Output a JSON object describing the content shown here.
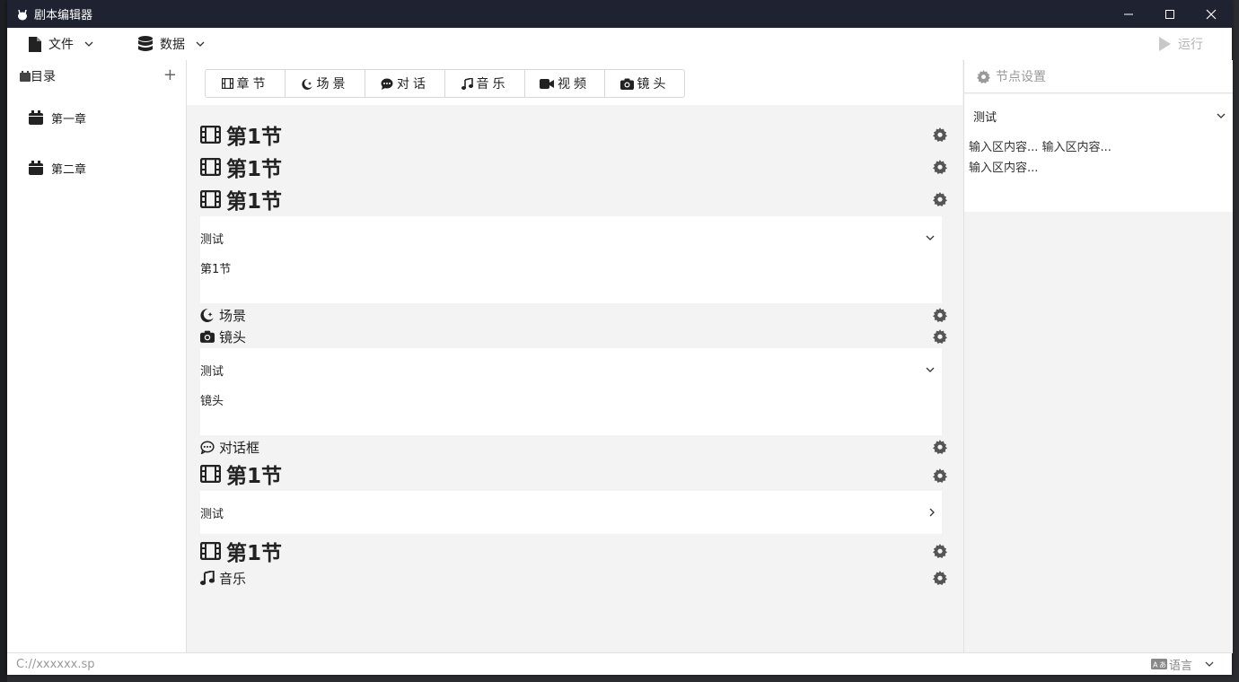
{
  "window": {
    "title": "剧本编辑器"
  },
  "menubar": {
    "file_label": "文件",
    "data_label": "数据",
    "run_label": "运行"
  },
  "sidebar": {
    "header": "目录",
    "items": [
      {
        "label": "第一章"
      },
      {
        "label": "第二章"
      }
    ]
  },
  "toolbar": {
    "tabs": [
      {
        "label": "章节",
        "icon": "film-icon"
      },
      {
        "label": "场景",
        "icon": "moon-star-icon"
      },
      {
        "label": "对话",
        "icon": "comment-icon"
      },
      {
        "label": "音乐",
        "icon": "music-icon"
      },
      {
        "label": "视频",
        "icon": "video-icon"
      },
      {
        "label": "镜头",
        "icon": "camera-icon"
      }
    ]
  },
  "nodes": {
    "n1": "第1节",
    "n2": "第1节",
    "n3": "第1节",
    "panel1": {
      "select": "测试",
      "content": "第1节"
    },
    "scene": "场景",
    "shot": "镜头",
    "panel2": {
      "select": "测试",
      "content": "镜头"
    },
    "dialog": "对话框",
    "n4": "第1节",
    "panel3": {
      "select": "测试"
    },
    "n5": "第1节",
    "music": "音乐"
  },
  "right_panel": {
    "header": "节点设置",
    "select": "测试",
    "text": "输入区内容... 输入区内容... 输入区内容..."
  },
  "statusbar": {
    "path": "C://xxxxxx.sp",
    "language_label": "语言"
  }
}
